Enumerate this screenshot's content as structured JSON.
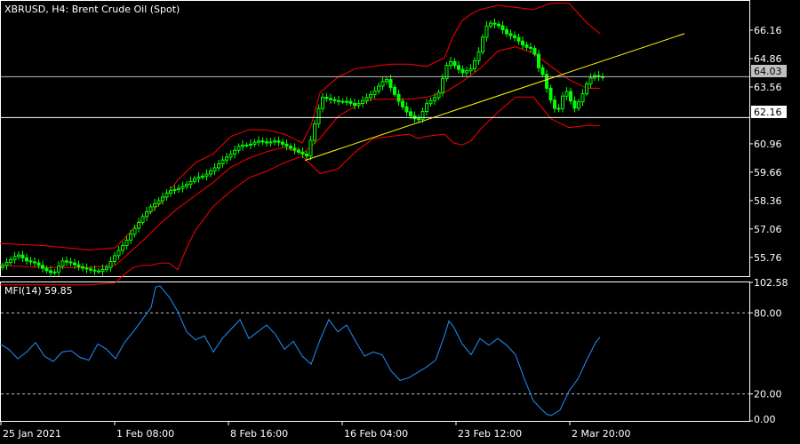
{
  "symbol_title": "XBRUSD, H4:  Brent Crude Oil (Spot)",
  "current_price": "64.03",
  "hline_price": "62.16",
  "mfi_title": "MFI(14) 59.85",
  "colors": {
    "background": "#000000",
    "bull": "#00ff00",
    "bands": "#ff0000",
    "trendline": "#ffff00",
    "mfi": "#1e90ff",
    "axis": "#ffffff",
    "grid": "#c0c0c0"
  },
  "chart_data": [
    {
      "type": "candlestick",
      "title": "XBRUSD, H4:  Brent Crude Oil (Spot)",
      "ylim": [
        54.9,
        67.5
      ],
      "y_ticks": [
        "66.16",
        "64.86",
        "63.56",
        "60.96",
        "59.66",
        "58.36",
        "57.06",
        "55.76"
      ],
      "x_ticks": [
        "25 Jan 2021",
        "1 Feb 08:00",
        "8 Feb 16:00",
        "16 Feb 04:00",
        "23 Feb 12:00",
        "2 Mar 20:00"
      ],
      "close_anchors": [
        [
          0,
          55.3
        ],
        [
          10,
          55.6
        ],
        [
          20,
          55.9
        ],
        [
          30,
          55.6
        ],
        [
          40,
          55.5
        ],
        [
          50,
          55.2
        ],
        [
          60,
          55.0
        ],
        [
          70,
          55.6
        ],
        [
          80,
          55.5
        ],
        [
          90,
          55.3
        ],
        [
          100,
          55.2
        ],
        [
          110,
          55.1
        ],
        [
          120,
          55.3
        ],
        [
          130,
          55.9
        ],
        [
          140,
          56.4
        ],
        [
          150,
          57.0
        ],
        [
          160,
          57.6
        ],
        [
          170,
          58.1
        ],
        [
          180,
          58.4
        ],
        [
          190,
          58.8
        ],
        [
          200,
          58.9
        ],
        [
          210,
          59.1
        ],
        [
          220,
          59.4
        ],
        [
          230,
          59.5
        ],
        [
          240,
          59.8
        ],
        [
          250,
          60.2
        ],
        [
          260,
          60.5
        ],
        [
          270,
          60.9
        ],
        [
          280,
          60.9
        ],
        [
          290,
          61.1
        ],
        [
          300,
          61.0
        ],
        [
          310,
          61.1
        ],
        [
          320,
          60.9
        ],
        [
          330,
          60.7
        ],
        [
          340,
          60.5
        ],
        [
          345,
          60.4
        ],
        [
          350,
          61.2
        ],
        [
          356,
          62.2
        ],
        [
          362,
          63.1
        ],
        [
          370,
          63.0
        ],
        [
          380,
          62.9
        ],
        [
          390,
          62.9
        ],
        [
          400,
          62.7
        ],
        [
          410,
          63.0
        ],
        [
          420,
          63.3
        ],
        [
          430,
          63.8
        ],
        [
          435,
          63.9
        ],
        [
          440,
          63.5
        ],
        [
          450,
          62.8
        ],
        [
          460,
          62.3
        ],
        [
          470,
          62.0
        ],
        [
          480,
          62.8
        ],
        [
          490,
          63.1
        ],
        [
          495,
          63.4
        ],
        [
          500,
          64.3
        ],
        [
          505,
          64.8
        ],
        [
          510,
          64.6
        ],
        [
          520,
          64.2
        ],
        [
          530,
          64.4
        ],
        [
          540,
          65.3
        ],
        [
          545,
          66.2
        ],
        [
          550,
          66.5
        ],
        [
          560,
          66.4
        ],
        [
          570,
          66.0
        ],
        [
          580,
          65.8
        ],
        [
          590,
          65.4
        ],
        [
          600,
          65.3
        ],
        [
          605,
          64.5
        ],
        [
          610,
          64.2
        ],
        [
          615,
          63.5
        ],
        [
          620,
          62.9
        ],
        [
          625,
          62.5
        ],
        [
          630,
          62.6
        ],
        [
          635,
          63.5
        ],
        [
          640,
          63.2
        ],
        [
          645,
          62.5
        ],
        [
          650,
          62.8
        ],
        [
          655,
          63.2
        ],
        [
          660,
          63.7
        ],
        [
          665,
          64.0
        ],
        [
          670,
          64.1
        ],
        [
          675,
          64.0
        ]
      ],
      "bollinger_upper": [
        [
          0,
          56.4
        ],
        [
          50,
          56.3
        ],
        [
          100,
          56.1
        ],
        [
          130,
          56.2
        ],
        [
          160,
          57.5
        ],
        [
          180,
          58.2
        ],
        [
          200,
          59.3
        ],
        [
          220,
          60.1
        ],
        [
          240,
          60.5
        ],
        [
          260,
          61.3
        ],
        [
          280,
          61.6
        ],
        [
          300,
          61.6
        ],
        [
          320,
          61.4
        ],
        [
          340,
          61.0
        ],
        [
          350,
          61.8
        ],
        [
          360,
          63.3
        ],
        [
          380,
          64.0
        ],
        [
          400,
          64.4
        ],
        [
          420,
          64.5
        ],
        [
          440,
          64.6
        ],
        [
          460,
          64.6
        ],
        [
          480,
          64.5
        ],
        [
          500,
          64.9
        ],
        [
          510,
          65.9
        ],
        [
          520,
          66.6
        ],
        [
          530,
          66.9
        ],
        [
          540,
          67.1
        ],
        [
          560,
          67.3
        ],
        [
          580,
          67.2
        ],
        [
          600,
          67.1
        ],
        [
          620,
          67.4
        ],
        [
          640,
          67.4
        ],
        [
          660,
          66.5
        ],
        [
          675,
          66.0
        ]
      ],
      "bollinger_middle": [
        [
          0,
          55.4
        ],
        [
          50,
          55.3
        ],
        [
          100,
          55.3
        ],
        [
          130,
          55.4
        ],
        [
          160,
          56.5
        ],
        [
          180,
          57.3
        ],
        [
          200,
          58.0
        ],
        [
          220,
          58.6
        ],
        [
          240,
          59.2
        ],
        [
          260,
          59.9
        ],
        [
          280,
          60.3
        ],
        [
          300,
          60.6
        ],
        [
          320,
          60.8
        ],
        [
          340,
          60.5
        ],
        [
          360,
          61.2
        ],
        [
          380,
          62.2
        ],
        [
          400,
          62.7
        ],
        [
          420,
          63.0
        ],
        [
          440,
          63.0
        ],
        [
          460,
          63.0
        ],
        [
          480,
          63.1
        ],
        [
          500,
          63.3
        ],
        [
          520,
          63.8
        ],
        [
          540,
          64.4
        ],
        [
          560,
          65.2
        ],
        [
          580,
          65.4
        ],
        [
          600,
          65.1
        ],
        [
          620,
          64.5
        ],
        [
          640,
          63.9
        ],
        [
          660,
          63.5
        ],
        [
          675,
          63.5
        ]
      ],
      "bollinger_lower": [
        [
          0,
          54.5
        ],
        [
          50,
          54.5
        ],
        [
          100,
          54.5
        ],
        [
          130,
          54.6
        ],
        [
          140,
          55.0
        ],
        [
          150,
          55.3
        ],
        [
          160,
          55.4
        ],
        [
          170,
          55.4
        ],
        [
          180,
          55.5
        ],
        [
          190,
          55.5
        ],
        [
          200,
          55.2
        ],
        [
          210,
          56.2
        ],
        [
          220,
          57.0
        ],
        [
          240,
          58.1
        ],
        [
          260,
          58.8
        ],
        [
          280,
          59.4
        ],
        [
          300,
          59.7
        ],
        [
          320,
          60.1
        ],
        [
          340,
          60.4
        ],
        [
          360,
          59.6
        ],
        [
          380,
          59.8
        ],
        [
          400,
          60.6
        ],
        [
          420,
          61.2
        ],
        [
          440,
          61.3
        ],
        [
          460,
          61.4
        ],
        [
          470,
          61.2
        ],
        [
          480,
          61.3
        ],
        [
          500,
          61.4
        ],
        [
          510,
          61.0
        ],
        [
          520,
          60.9
        ],
        [
          530,
          61.1
        ],
        [
          540,
          61.6
        ],
        [
          560,
          62.4
        ],
        [
          580,
          63.1
        ],
        [
          600,
          63.1
        ],
        [
          620,
          62.1
        ],
        [
          640,
          61.7
        ],
        [
          660,
          61.8
        ],
        [
          675,
          61.8
        ]
      ],
      "trendline": [
        [
          343,
          60.2
        ],
        [
          770,
          66.0
        ]
      ],
      "hlines": [
        64.03,
        62.16
      ]
    },
    {
      "type": "line",
      "title": "MFI(14) 59.85",
      "ylim": [
        0,
        102.58
      ],
      "y_ticks": [
        "102.58",
        "80.00",
        "20.00",
        "0.00"
      ],
      "levels": [
        80,
        20
      ],
      "series": [
        {
          "values": [
            [
              0,
              57
            ],
            [
              10,
              53
            ],
            [
              20,
              46
            ],
            [
              30,
              51
            ],
            [
              40,
              58
            ],
            [
              50,
              48
            ],
            [
              60,
              44
            ],
            [
              70,
              51
            ],
            [
              80,
              52
            ],
            [
              90,
              47
            ],
            [
              100,
              45
            ],
            [
              110,
              57
            ],
            [
              120,
              53
            ],
            [
              130,
              46
            ],
            [
              140,
              58
            ],
            [
              150,
              66
            ],
            [
              160,
              75
            ],
            [
              170,
              84
            ],
            [
              175,
              99
            ],
            [
              180,
              100
            ],
            [
              190,
              92
            ],
            [
              200,
              81
            ],
            [
              210,
              66
            ],
            [
              220,
              60
            ],
            [
              230,
              63
            ],
            [
              240,
              51
            ],
            [
              250,
              61
            ],
            [
              260,
              68
            ],
            [
              270,
              75
            ],
            [
              280,
              61
            ],
            [
              290,
              66
            ],
            [
              300,
              71
            ],
            [
              310,
              64
            ],
            [
              320,
              53
            ],
            [
              330,
              59
            ],
            [
              340,
              48
            ],
            [
              350,
              42
            ],
            [
              360,
              60
            ],
            [
              370,
              75
            ],
            [
              380,
              66
            ],
            [
              390,
              71
            ],
            [
              400,
              59
            ],
            [
              410,
              48
            ],
            [
              420,
              51
            ],
            [
              430,
              49
            ],
            [
              440,
              37
            ],
            [
              450,
              30
            ],
            [
              460,
              32
            ],
            [
              470,
              36
            ],
            [
              480,
              40
            ],
            [
              490,
              45
            ],
            [
              500,
              63
            ],
            [
              505,
              74
            ],
            [
              510,
              70
            ],
            [
              520,
              57
            ],
            [
              530,
              49
            ],
            [
              540,
              61
            ],
            [
              550,
              56
            ],
            [
              560,
              61
            ],
            [
              570,
              56
            ],
            [
              580,
              49
            ],
            [
              590,
              31
            ],
            [
              600,
              15
            ],
            [
              610,
              8
            ],
            [
              615,
              5
            ],
            [
              620,
              4
            ],
            [
              630,
              8
            ],
            [
              640,
              22
            ],
            [
              650,
              31
            ],
            [
              660,
              45
            ],
            [
              670,
              58
            ],
            [
              675,
              62
            ]
          ]
        }
      ]
    }
  ]
}
